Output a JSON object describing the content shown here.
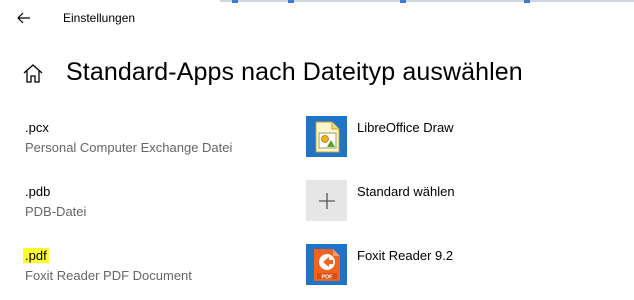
{
  "window": {
    "title": "Einstellungen"
  },
  "page": {
    "title": "Standard-Apps nach Dateityp auswählen"
  },
  "colors": {
    "highlight": "#ffff2e",
    "tile_blue": "#1d74c9",
    "tile_gray": "#e6e6e6",
    "tile_orange": "#f26322"
  },
  "file_types": [
    {
      "extension": ".pcx",
      "description": "Personal Computer Exchange Datei",
      "app_name": "LibreOffice Draw",
      "app_icon": "libreoffice-draw-icon"
    },
    {
      "extension": ".pdb",
      "description": "PDB-Datei",
      "app_name": "Standard wählen",
      "app_icon": "plus-icon"
    },
    {
      "extension": ".pdf",
      "description": "Foxit Reader PDF Document",
      "app_name": "Foxit Reader 9.2",
      "app_icon": "foxit-reader-icon",
      "highlighted": true
    }
  ],
  "icons": {
    "back": "back-arrow-icon",
    "home": "home-icon"
  }
}
